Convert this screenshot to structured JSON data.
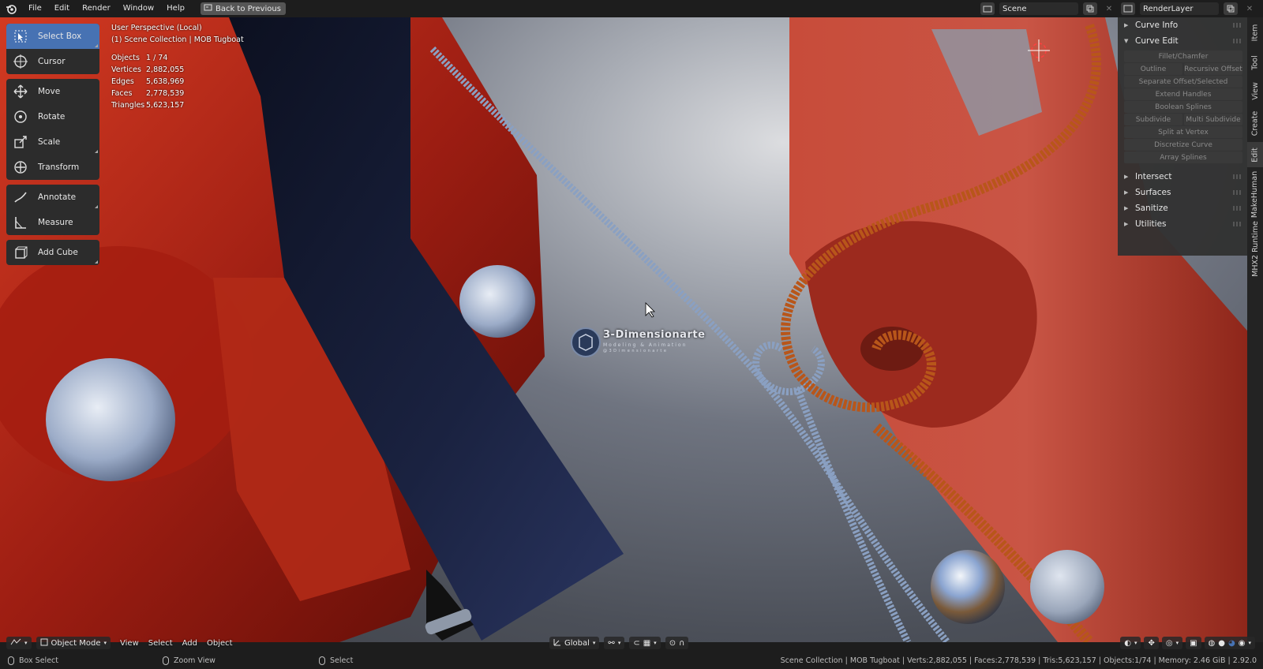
{
  "topbar": {
    "menus": [
      "File",
      "Edit",
      "Render",
      "Window",
      "Help"
    ],
    "back_button": "Back to Previous",
    "scene": "Scene",
    "render_layer": "RenderLayer"
  },
  "toolbar": {
    "tools": [
      {
        "label": "Select Box",
        "icon": "select-box-icon"
      },
      {
        "label": "Cursor",
        "icon": "cursor-icon"
      },
      {
        "label": "Move",
        "icon": "move-icon"
      },
      {
        "label": "Rotate",
        "icon": "rotate-icon"
      },
      {
        "label": "Scale",
        "icon": "scale-icon"
      },
      {
        "label": "Transform",
        "icon": "transform-icon"
      },
      {
        "label": "Annotate",
        "icon": "annotate-icon"
      },
      {
        "label": "Measure",
        "icon": "measure-icon"
      },
      {
        "label": "Add Cube",
        "icon": "add-cube-icon"
      }
    ]
  },
  "overlay": {
    "view_name": "User Perspective (Local)",
    "collection": "(1) Scene Collection | MOB Tugboat",
    "stats": [
      {
        "key": "Objects",
        "value": "1 / 74"
      },
      {
        "key": "Vertices",
        "value": "2,882,055"
      },
      {
        "key": "Edges",
        "value": "5,638,969"
      },
      {
        "key": "Faces",
        "value": "2,778,539"
      },
      {
        "key": "Triangles",
        "value": "5,623,157"
      }
    ]
  },
  "watermark": {
    "title": "3-Dimensionarte",
    "subtitle": "Modeling & Animation",
    "handle": "@3Dimensionarte"
  },
  "npanel": {
    "curve_info": "Curve Info",
    "curve_edit": "Curve Edit",
    "buttons": {
      "fillet": "Fillet/Chamfer",
      "outline": "Outline",
      "recursive_offset": "Recursive Offset",
      "separate_offset": "Separate Offset/Selected",
      "extend_handles": "Extend Handles",
      "boolean_splines": "Boolean Splines",
      "subdivide": "Subdivide",
      "multi_subdivide": "Multi Subdivide",
      "split_at_vertex": "Split at Vertex",
      "discretize_curve": "Discretize Curve",
      "array_splines": "Array Splines"
    },
    "intersect": "Intersect",
    "surfaces": "Surfaces",
    "sanitize": "Sanitize",
    "utilities": "Utilities"
  },
  "tabs": [
    "Item",
    "Tool",
    "View",
    "Create",
    "Edit",
    "MakeHuman",
    "MHX2 Runtime"
  ],
  "header": {
    "mode": "Object Mode",
    "menus": [
      "View",
      "Select",
      "Add",
      "Object"
    ],
    "orientation": "Global"
  },
  "statusbar": {
    "left": "Box Select",
    "middle": "Zoom View",
    "right_action": "Select",
    "info": "Scene Collection | MOB Tugboat | Verts:2,882,055 | Faces:2,778,539 | Tris:5,623,157 | Objects:1/74 | Memory: 2.46 GiB | 2.92.0"
  },
  "colors": {
    "accent": "#4772b3",
    "ui_bg": "#1d1d1d",
    "boat_red": "#b0241a",
    "rope_blue": "#93a6c4",
    "rope_orange": "#b8561a"
  }
}
